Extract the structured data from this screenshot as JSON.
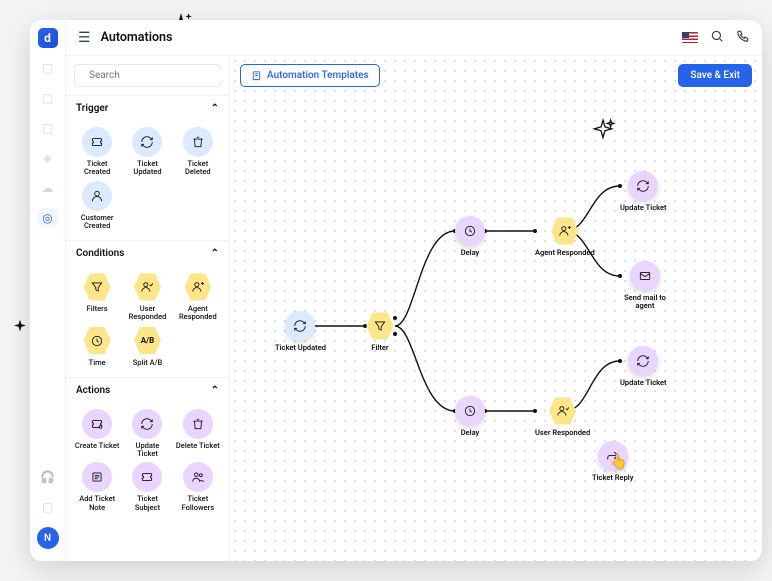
{
  "header": {
    "title": "Automations",
    "avatar_letter": "N"
  },
  "search": {
    "placeholder": "Search"
  },
  "sections": {
    "trigger": {
      "title": "Trigger",
      "items": [
        {
          "label": "Ticket Created"
        },
        {
          "label": "Ticket Updated"
        },
        {
          "label": "Ticket Deleted"
        },
        {
          "label": "Customer Created"
        }
      ]
    },
    "conditions": {
      "title": "Conditions",
      "items": [
        {
          "label": "Filters"
        },
        {
          "label": "User Responded"
        },
        {
          "label": "Agent Responded"
        },
        {
          "label": "Time"
        },
        {
          "label": "Split A/B",
          "ab": true
        }
      ]
    },
    "actions": {
      "title": "Actions",
      "items": [
        {
          "label": "Create Ticket"
        },
        {
          "label": "Update Ticket"
        },
        {
          "label": "Delete Ticket"
        },
        {
          "label": "Add Ticket Note"
        },
        {
          "label": "Ticket Subject"
        },
        {
          "label": "Ticket Followers"
        }
      ]
    }
  },
  "canvas": {
    "templates_btn": "Automation Templates",
    "save_btn": "Save & Exit",
    "nodes": {
      "start": "Ticket Updated",
      "filter": "Filter",
      "delay1": "Delay",
      "agent": "Agent Responded",
      "update1": "Update Ticket",
      "mail": "Send mail to agent",
      "delay2": "Delay",
      "user": "User Responded",
      "update2": "Update Ticket",
      "reply": "Ticket Reply"
    }
  }
}
